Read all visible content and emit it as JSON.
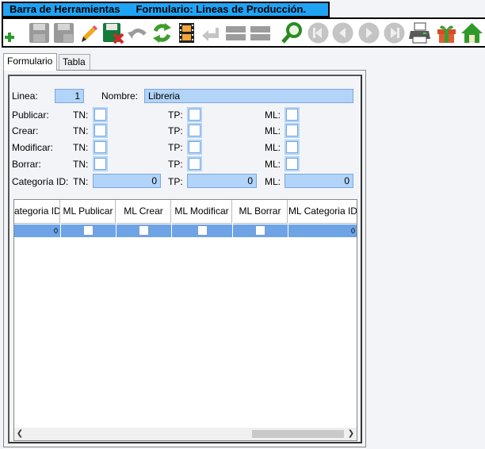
{
  "title_bar": {
    "app_title": "Barra de Herramientas",
    "form_title": "Formulario: Lineas de Producción."
  },
  "toolbar": {
    "buttons": [
      {
        "icon": "add-icon",
        "enabled": true
      },
      {
        "icon": "save-icon",
        "enabled": false
      },
      {
        "icon": "save-as-icon",
        "enabled": false
      },
      {
        "icon": "edit-icon",
        "enabled": true
      },
      {
        "icon": "save-cancel-icon",
        "enabled": true
      },
      {
        "icon": "undo-icon",
        "enabled": false
      },
      {
        "icon": "refresh-icon",
        "enabled": true
      },
      {
        "icon": "film-icon",
        "enabled": true
      },
      {
        "icon": "back-arrow-icon",
        "enabled": false
      },
      {
        "icon": "blank-icon",
        "enabled": false
      },
      {
        "icon": "blank-icon",
        "enabled": false
      },
      {
        "icon": "search-icon",
        "enabled": true
      },
      {
        "icon": "first-record-icon",
        "enabled": false
      },
      {
        "icon": "previous-record-icon",
        "enabled": false
      },
      {
        "icon": "next-record-icon",
        "enabled": false
      },
      {
        "icon": "last-record-icon",
        "enabled": false
      },
      {
        "icon": "printer-icon",
        "enabled": true
      },
      {
        "icon": "gift-icon",
        "enabled": true
      },
      {
        "icon": "home-icon",
        "enabled": true
      }
    ]
  },
  "tabs": [
    {
      "label": "Formulario",
      "active": true
    },
    {
      "label": "Tabla",
      "active": false
    }
  ],
  "form": {
    "linea_label": "Linea:",
    "linea_value": "1",
    "nombre_label": "Nombre:",
    "nombre_value": "Libreria",
    "publicar_label": "Publicar:",
    "crear_label": "Crear:",
    "modificar_label": "Modificar:",
    "borrar_label": "Borrar:",
    "categoria_label": "Categoría ID:",
    "tn_label": "TN:",
    "tp_label": "TP:",
    "ml_label": "ML:",
    "categoria_tn_value": "0",
    "categoria_tp_value": "0",
    "categoria_ml_value": "0"
  },
  "grid": {
    "columns": [
      "ategoria ID",
      "ML Publicar",
      "ML Crear",
      "ML Modificar",
      "ML Borrar",
      "ML Categoria ID"
    ],
    "row": {
      "categoria_id": "0",
      "ml_categoria_id": "0"
    },
    "scroll_left_arrow": "❮",
    "scroll_right_arrow": "❯"
  },
  "colors": {
    "title_bar": "#1fa3f5",
    "input_fill": "#b2d4f8",
    "selected_row": "#6ea3e6",
    "background": "#f3f4f8"
  }
}
